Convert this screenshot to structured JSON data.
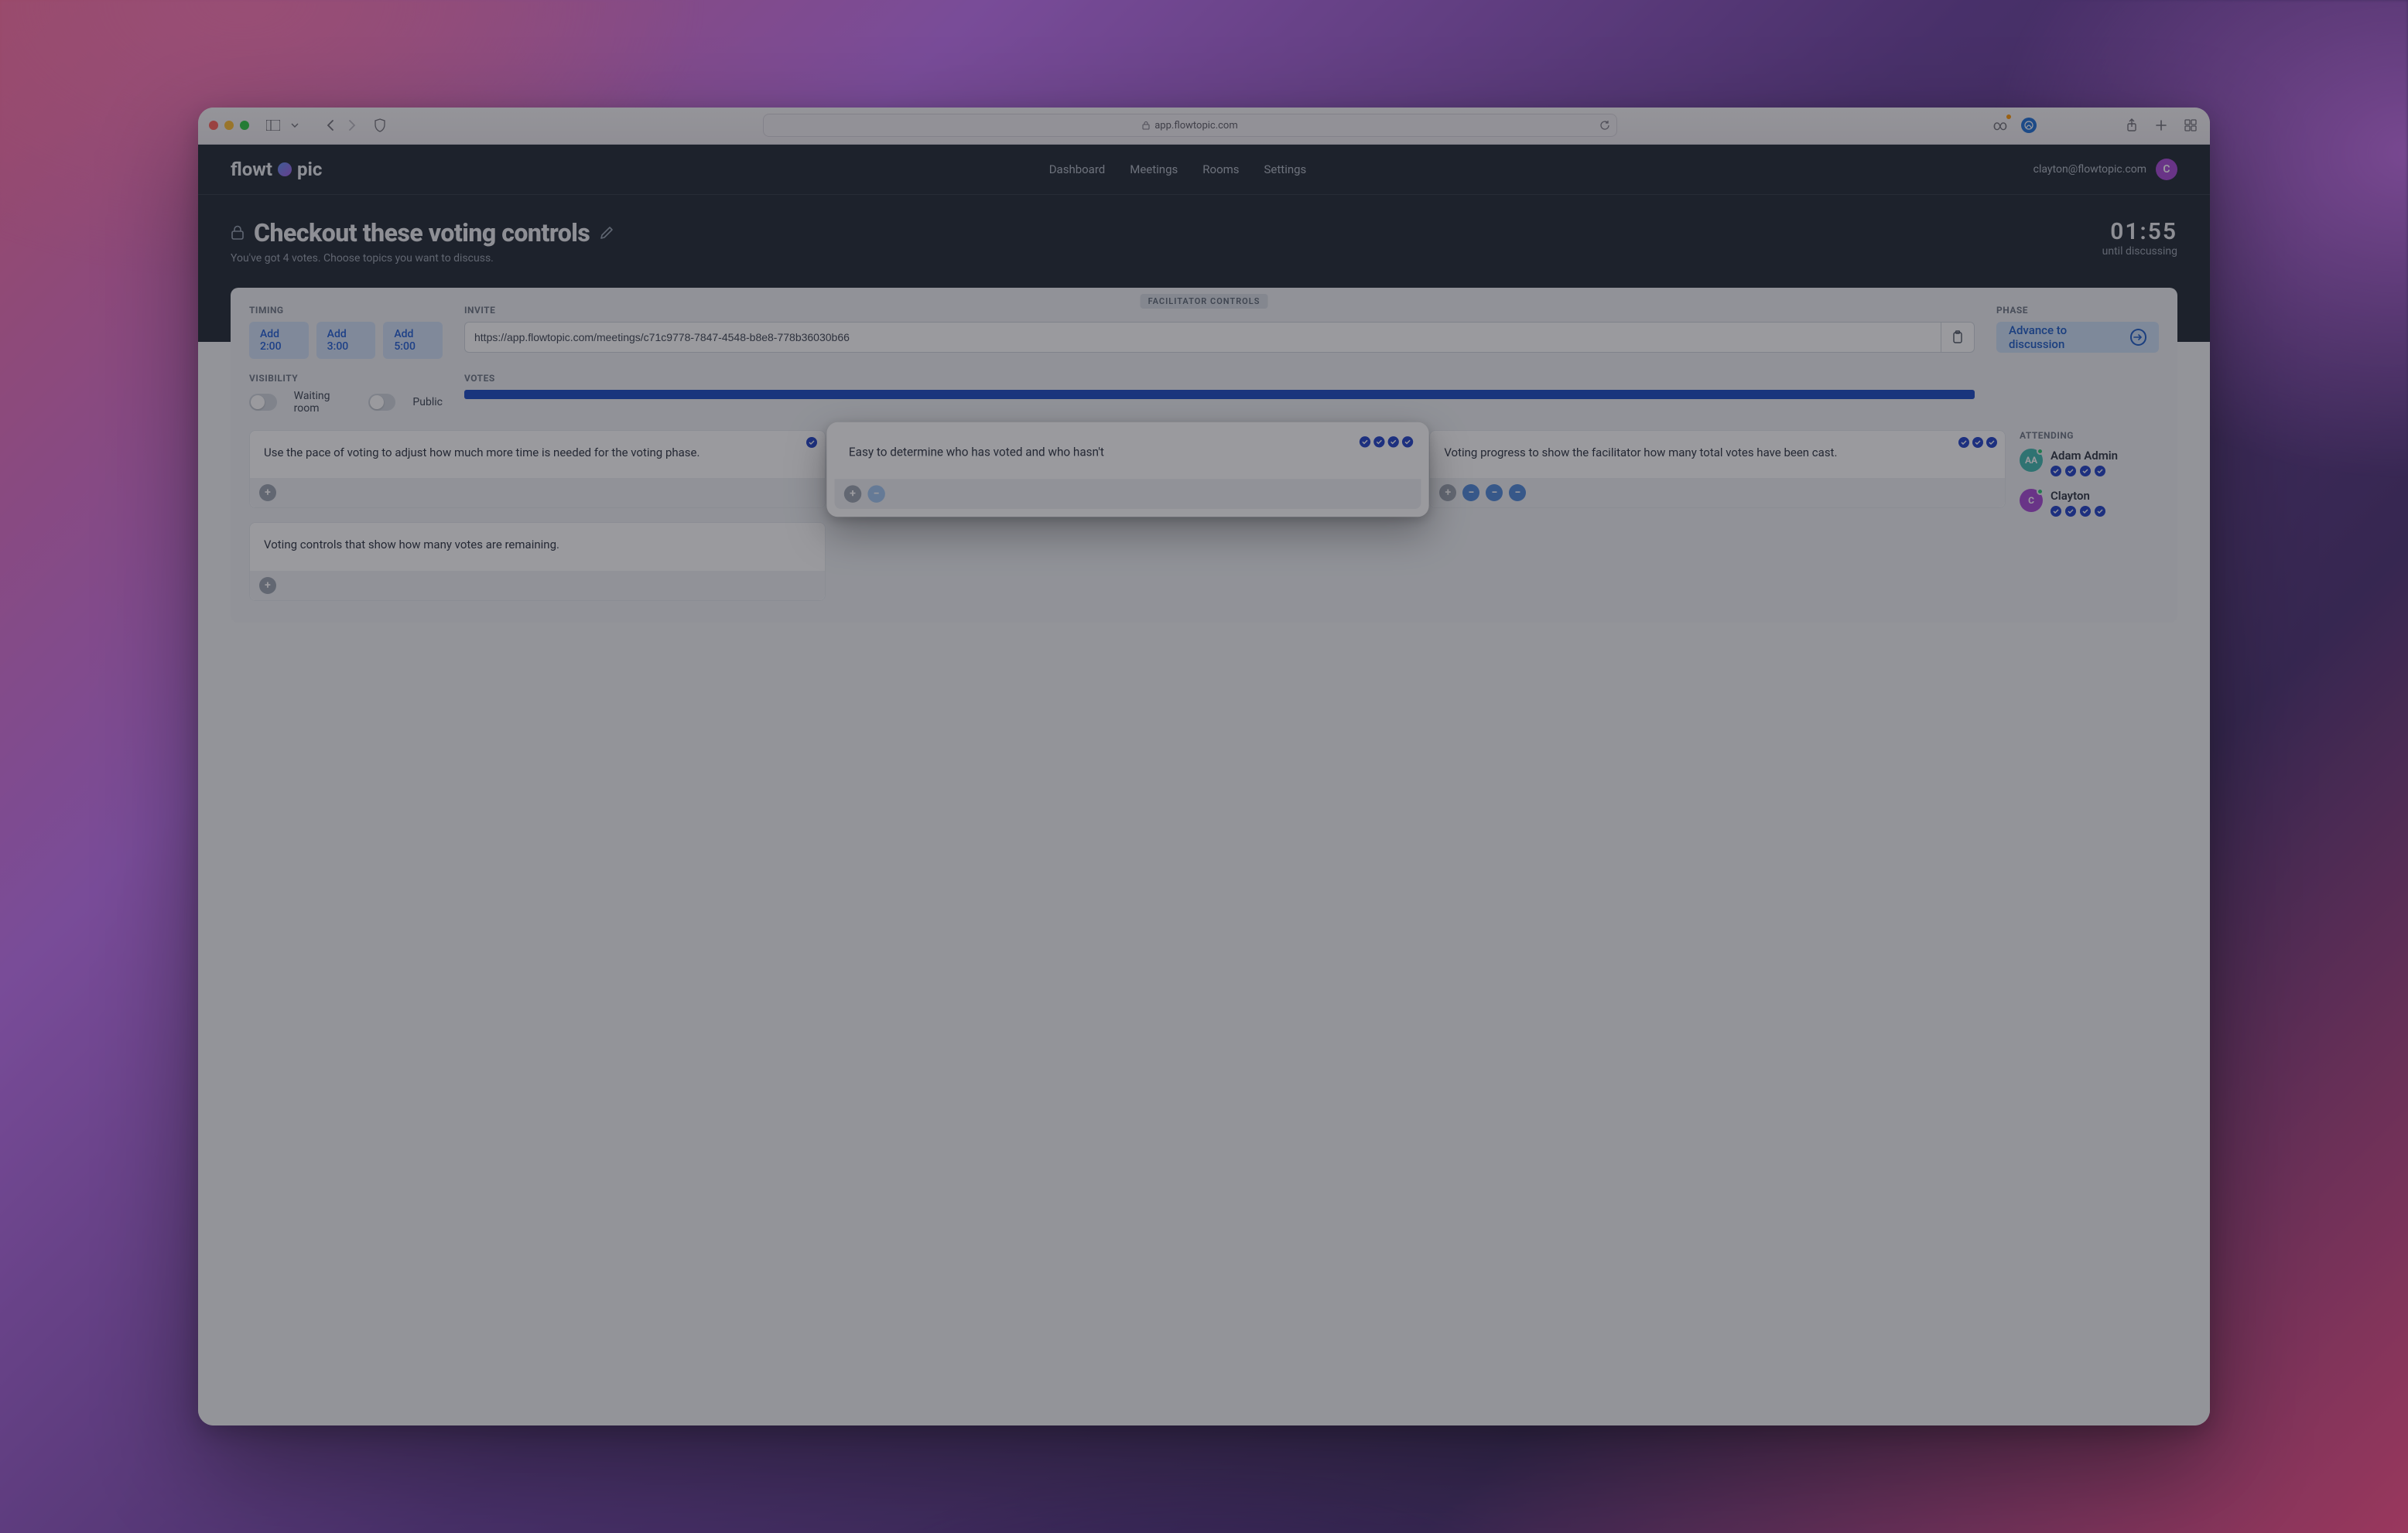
{
  "browser": {
    "address": "app.flowtopic.com"
  },
  "nav": {
    "brand_prefix": "flowt",
    "brand_suffix": "pic",
    "links": {
      "dashboard": "Dashboard",
      "meetings": "Meetings",
      "rooms": "Rooms",
      "settings": "Settings"
    },
    "account_email": "clayton@flowtopic.com",
    "account_initial": "C"
  },
  "page": {
    "title": "Checkout these voting controls",
    "subtitle": "You've got 4 votes. Choose topics you want to discuss.",
    "timer": "01:55",
    "timer_label": "until discussing"
  },
  "controls": {
    "tag": "FACILITATOR CONTROLS",
    "timing_label": "TIMING",
    "timing": {
      "a": "Add 2:00",
      "b": "Add 3:00",
      "c": "Add 5:00"
    },
    "invite_label": "INVITE",
    "invite_url": "https://app.flowtopic.com/meetings/c71c9778-7847-4548-b8e8-778b36030b66",
    "phase_label": "PHASE",
    "phase_button": "Advance to discussion",
    "visibility_label": "VISIBILITY",
    "vis_waiting": "Waiting room",
    "vis_public": "Public",
    "votes_label": "VOTES"
  },
  "topics": {
    "t1": "Use the pace of voting to adjust how much more time is needed for the voting phase.",
    "t2": "Voting controls that show how many votes are remaining.",
    "t3": "Easy to determine who has voted and who hasn't",
    "t4": "Voting progress to show the facilitator how many total votes have been cast."
  },
  "attending": {
    "label": "ATTENDING",
    "adam": {
      "initials": "AA",
      "name": "Adam Admin"
    },
    "clayton": {
      "initials": "C",
      "name": "Clayton"
    }
  }
}
